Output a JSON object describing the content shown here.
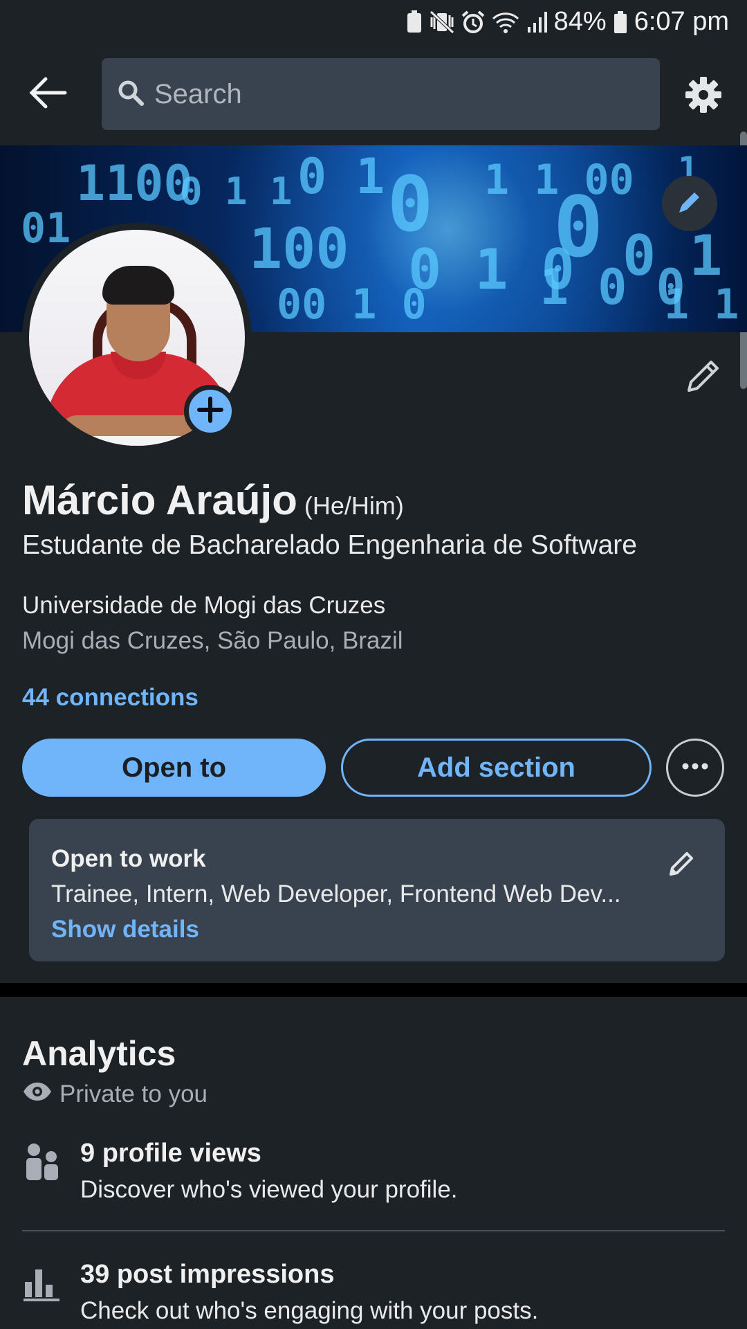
{
  "status_bar": {
    "battery": "84%",
    "time": "6:07 pm"
  },
  "header": {
    "search_placeholder": "Search"
  },
  "profile": {
    "name": "Márcio Araújo",
    "pronouns": "(He/Him)",
    "headline": "Estudante de Bacharelado Engenharia de Software",
    "school": "Universidade de Mogi das Cruzes",
    "location": "Mogi das Cruzes, São Paulo, Brazil",
    "connections": "44 connections"
  },
  "actions": {
    "open_to": "Open to",
    "add_section": "Add section"
  },
  "open_to_work": {
    "title": "Open to work",
    "roles": "Trainee, Intern, Web Developer, Frontend Web Dev...",
    "link": "Show details"
  },
  "analytics": {
    "title": "Analytics",
    "privacy": "Private to you",
    "items": [
      {
        "icon": "people-icon",
        "title": "9 profile views",
        "desc": "Discover who's viewed your profile."
      },
      {
        "icon": "bar-chart-icon",
        "title": "39 post impressions",
        "desc": "Check out who's engaging with your posts."
      }
    ]
  },
  "colors": {
    "background": "#1d2226",
    "accent": "#70b5f9",
    "card": "#38434f"
  }
}
